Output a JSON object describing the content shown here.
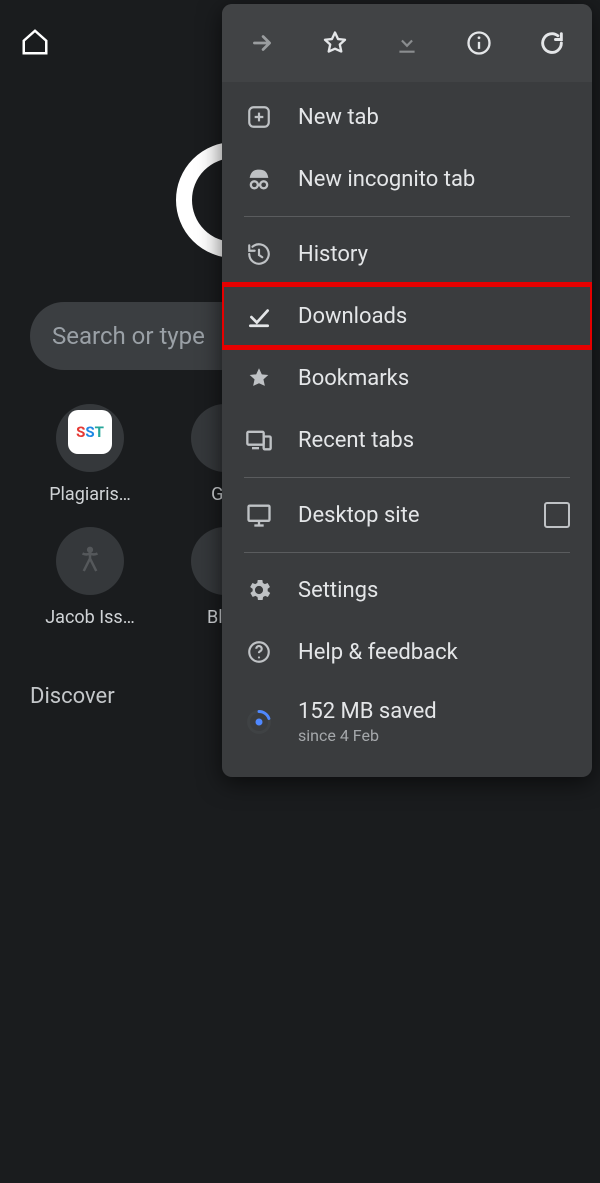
{
  "topbar": {},
  "omnibox": {
    "placeholder": "Search or type"
  },
  "shortcuts": [
    {
      "id": "sst",
      "label": "Plagiaris…",
      "tile": "SST"
    },
    {
      "id": "grammar",
      "label": "Gra"
    },
    {
      "id": "jacob",
      "label": "Jacob Iss…"
    },
    {
      "id": "blog",
      "label": "Blog"
    }
  ],
  "discover": {
    "heading": "Discover"
  },
  "menu": {
    "items": {
      "new_tab": "New tab",
      "incognito": "New incognito tab",
      "history": "History",
      "downloads": "Downloads",
      "bookmarks": "Bookmarks",
      "recent_tabs": "Recent tabs",
      "desktop_site": "Desktop site",
      "settings": "Settings",
      "help": "Help & feedback"
    },
    "data_saver": {
      "main": "152 MB saved",
      "sub": "since 4 Feb"
    },
    "highlighted_item": "downloads"
  }
}
